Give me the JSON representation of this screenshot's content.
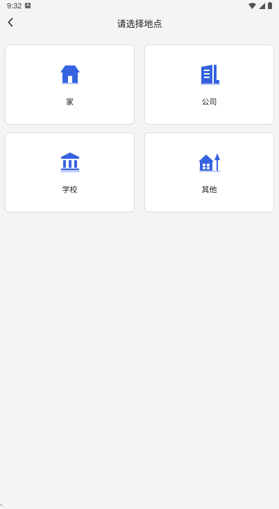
{
  "status_bar": {
    "time": "9:32",
    "notification": "A",
    "icons": [
      "wifi-icon",
      "signal-icon",
      "battery-icon"
    ]
  },
  "header": {
    "title": "请选择地点",
    "back_icon": "chevron-left-icon"
  },
  "locations": [
    {
      "label": "家",
      "icon": "house-icon"
    },
    {
      "label": "公司",
      "icon": "office-building-icon"
    },
    {
      "label": "学校",
      "icon": "school-building-icon"
    },
    {
      "label": "其他",
      "icon": "house-with-tree-icon"
    }
  ],
  "colors": {
    "accent": "#3563e0",
    "background": "#f4f4f6",
    "card": "#ffffff",
    "card_border": "#dcdce2"
  }
}
